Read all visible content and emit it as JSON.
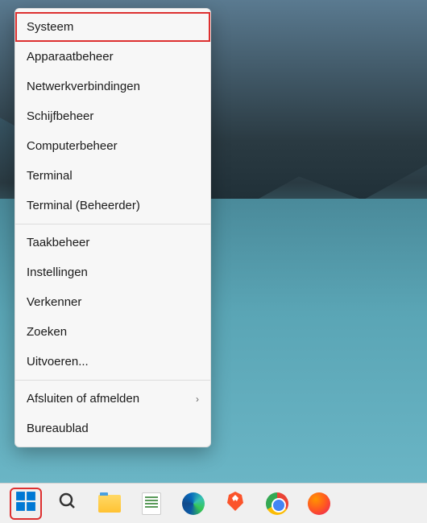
{
  "context_menu": {
    "groups": [
      [
        {
          "label": "Systeem",
          "highlighted": true
        },
        {
          "label": "Apparaatbeheer"
        },
        {
          "label": "Netwerkverbindingen"
        },
        {
          "label": "Schijfbeheer"
        },
        {
          "label": "Computerbeheer"
        },
        {
          "label": "Terminal"
        },
        {
          "label": "Terminal (Beheerder)"
        }
      ],
      [
        {
          "label": "Taakbeheer"
        },
        {
          "label": "Instellingen"
        },
        {
          "label": "Verkenner"
        },
        {
          "label": "Zoeken"
        },
        {
          "label": "Uitvoeren..."
        }
      ],
      [
        {
          "label": "Afsluiten of afmelden",
          "submenu": true
        },
        {
          "label": "Bureaublad"
        }
      ]
    ]
  },
  "taskbar": {
    "items": [
      {
        "name": "start-button",
        "icon": "windows-icon",
        "highlighted": true
      },
      {
        "name": "search-button",
        "icon": "search-icon"
      },
      {
        "name": "file-explorer",
        "icon": "folder-icon"
      },
      {
        "name": "notepad-plus",
        "icon": "notepad-icon"
      },
      {
        "name": "microsoft-edge",
        "icon": "edge-icon"
      },
      {
        "name": "brave-browser",
        "icon": "brave-icon"
      },
      {
        "name": "google-chrome",
        "icon": "chrome-icon"
      },
      {
        "name": "firefox",
        "icon": "firefox-icon"
      }
    ]
  }
}
